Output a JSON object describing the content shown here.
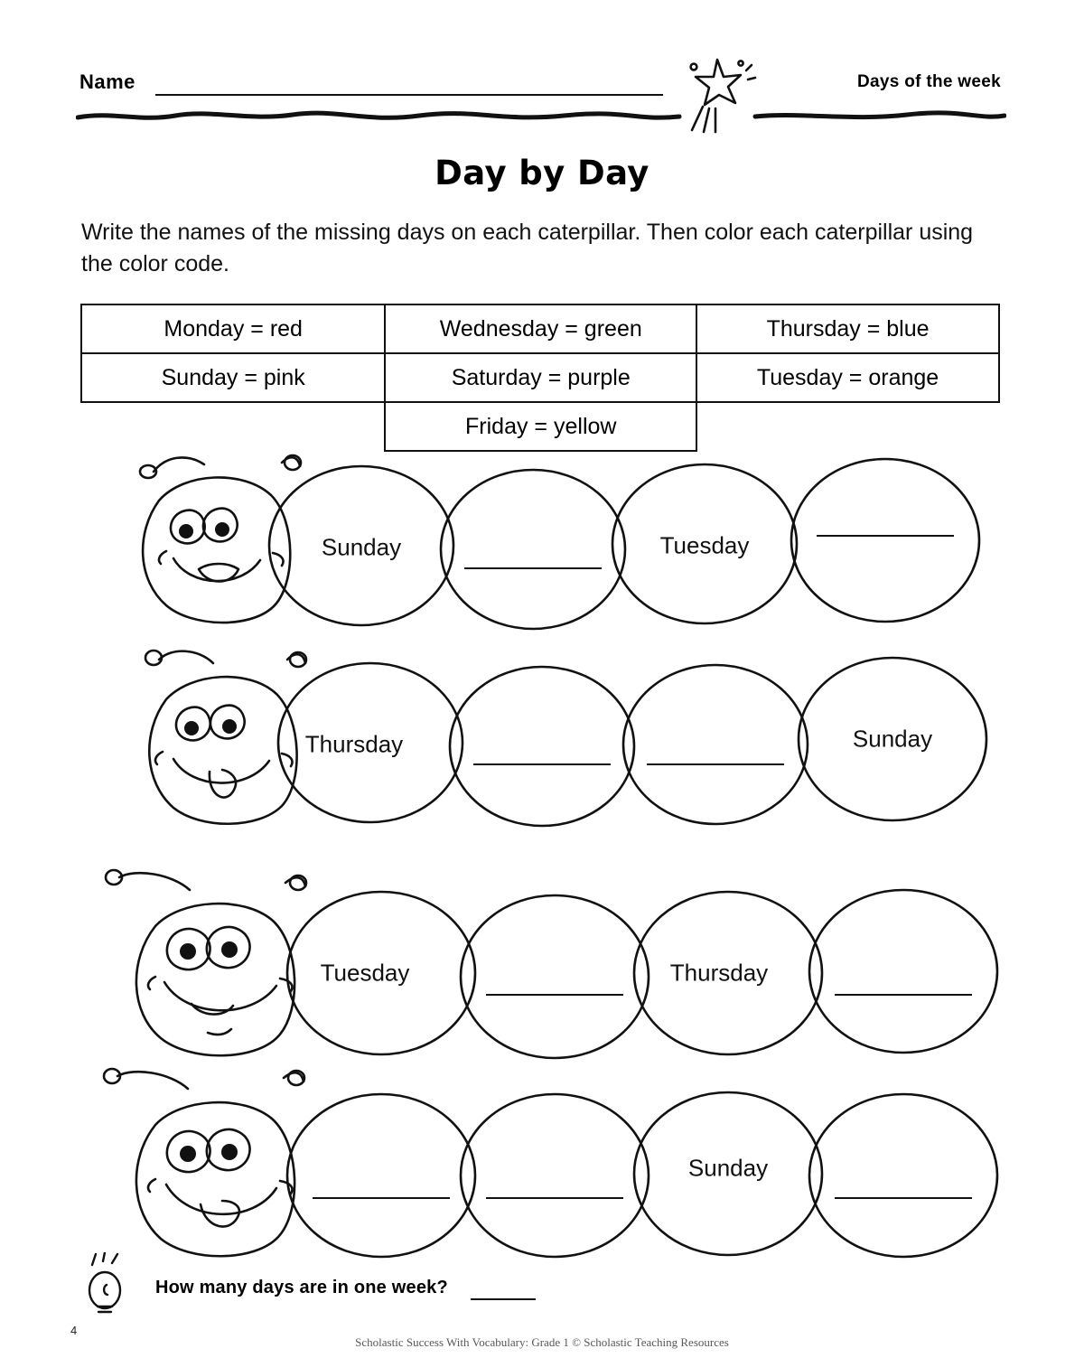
{
  "header": {
    "name_label": "Name",
    "topic_label": "Days of the week",
    "star_icon": "star-icon"
  },
  "title": "Day by Day",
  "instructions": "Write the names of the missing days on each caterpillar. Then color each caterpillar using the color code.",
  "color_code": {
    "rows": [
      [
        "Monday = red",
        "Wednesday = green",
        "Thursday = blue"
      ],
      [
        "Sunday = pink",
        "Saturday = purple",
        "Tuesday = orange"
      ],
      [
        "",
        "Friday = yellow",
        ""
      ]
    ]
  },
  "caterpillars": [
    {
      "segments": [
        "Sunday",
        "",
        "Tuesday",
        ""
      ]
    },
    {
      "segments": [
        "Thursday",
        "",
        "",
        "Sunday"
      ]
    },
    {
      "segments": [
        "Tuesday",
        "",
        "Thursday",
        ""
      ]
    },
    {
      "segments": [
        "",
        "",
        "Sunday",
        ""
      ]
    }
  ],
  "footer": {
    "bulb_icon": "lightbulb-icon",
    "question": "How many days are in one week?",
    "page_number": "4",
    "credit": "Scholastic Success With Vocabulary: Grade 1 © Scholastic Teaching Resources"
  }
}
